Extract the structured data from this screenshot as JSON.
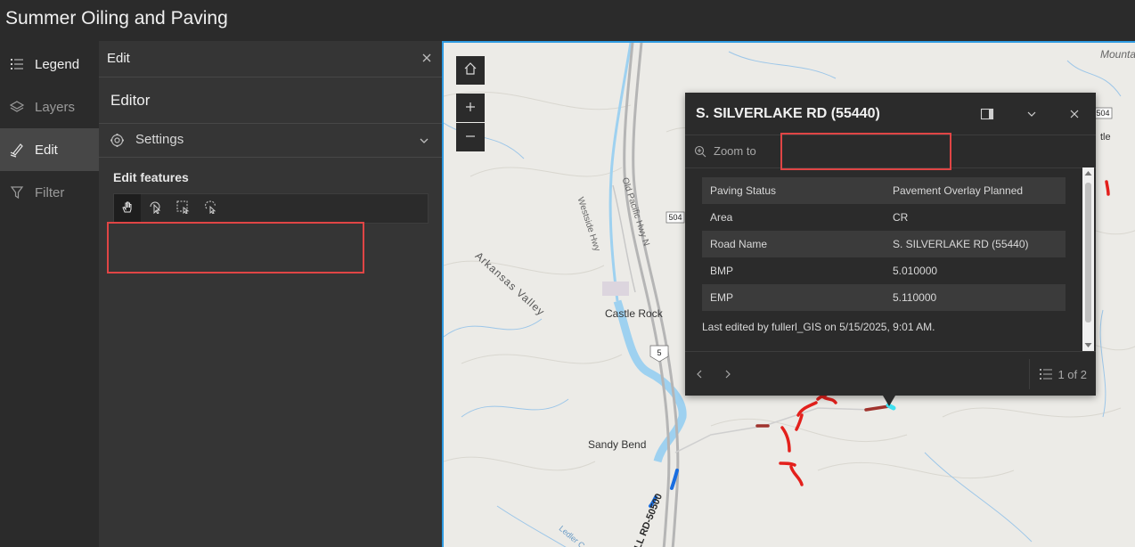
{
  "app": {
    "title": "Summer Oiling and Paving"
  },
  "rail": {
    "items": [
      {
        "label": "Legend",
        "icon": "legend-icon",
        "active": false
      },
      {
        "label": "Layers",
        "icon": "layers-icon",
        "active": false
      },
      {
        "label": "Edit",
        "icon": "edit-icon",
        "active": true
      },
      {
        "label": "Filter",
        "icon": "filter-icon",
        "active": false
      }
    ]
  },
  "panel": {
    "header": "Edit",
    "editor_title": "Editor",
    "settings_label": "Settings",
    "edit_features_label": "Edit features",
    "tools": [
      "pan-tool-icon",
      "select-tool-icon",
      "rectangle-select-icon",
      "lasso-select-icon"
    ]
  },
  "map": {
    "places": [
      "Castle Rock",
      "Sandy Bend",
      "Arkansas Valley",
      "Westside Hwy",
      "Old Pacific Hwy N",
      "LL RD-50500",
      "Mounta",
      "tle",
      "Ledler C"
    ],
    "shields": [
      "504",
      "5",
      "504"
    ],
    "accent_color": "#2f9be2",
    "road_colors": {
      "planned": "#e3201c",
      "other": "#a0332d",
      "complete": "#1a6ee0"
    }
  },
  "popup": {
    "title": "S. SILVERLAKE RD (55440)",
    "zoom_label": "Zoom to",
    "attributes": [
      {
        "key": "Paving Status",
        "value": "Pavement Overlay Planned"
      },
      {
        "key": "Area",
        "value": "CR"
      },
      {
        "key": "Road Name",
        "value": "S. SILVERLAKE RD (55440)"
      },
      {
        "key": "BMP",
        "value": "5.010000"
      },
      {
        "key": "EMP",
        "value": "5.110000"
      }
    ],
    "last_edited": "Last edited by fullerl_GIS on 5/15/2025, 9:01 AM.",
    "pagination": "1 of 2"
  }
}
